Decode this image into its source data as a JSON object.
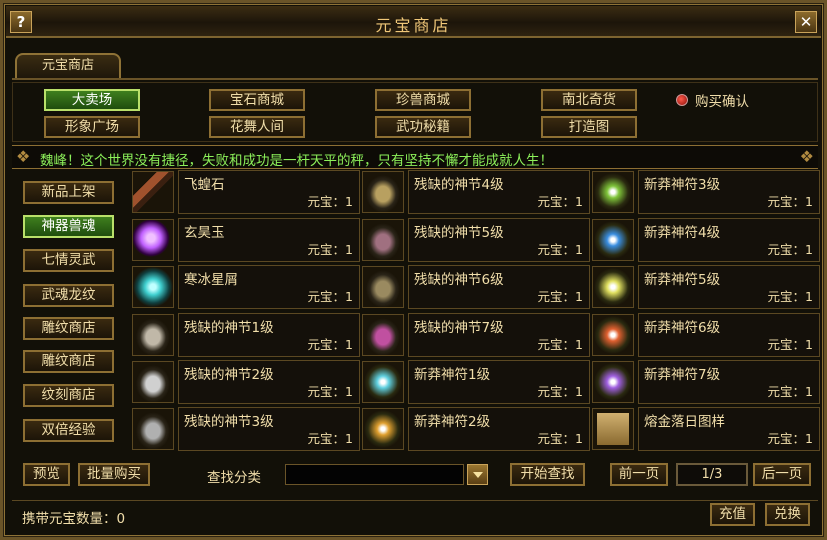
{
  "window": {
    "title": "元宝商店",
    "help_label": "?",
    "close_label": "✕"
  },
  "top_tab": {
    "label": "元宝商店"
  },
  "categories": [
    {
      "label": "大卖场",
      "active": true
    },
    {
      "label": "宝石商城",
      "active": false
    },
    {
      "label": "珍兽商城",
      "active": false
    },
    {
      "label": "南北奇货",
      "active": false
    },
    {
      "label": "形象广场",
      "active": false
    },
    {
      "label": "花舞人间",
      "active": false
    },
    {
      "label": "武功秘籍",
      "active": false
    },
    {
      "label": "打造图",
      "active": false
    }
  ],
  "confirm": {
    "label": "购买确认"
  },
  "notice": {
    "text": "魏峰！这个世界没有捷径，失败和成功是一杆天平的秤，只有坚持不懈才能成就人生！"
  },
  "sidebar": [
    {
      "label": "新品上架",
      "active": false
    },
    {
      "label": "神器兽魂",
      "active": true
    },
    {
      "label": "七情灵武",
      "active": false
    },
    {
      "label": "武魂龙纹",
      "active": false
    },
    {
      "label": "雕纹商店",
      "active": false
    },
    {
      "label": "雕纹商店",
      "active": false
    },
    {
      "label": "纹刻商店",
      "active": false
    },
    {
      "label": "双倍经验",
      "active": false
    }
  ],
  "items": [
    {
      "name": "飞蝗石",
      "price": "元宝：1",
      "icon": "stone-icon",
      "color": "#a0522d"
    },
    {
      "name": "残缺的神节4级",
      "price": "元宝：1",
      "icon": "artifact-fragment-icon",
      "color": "#b8a060"
    },
    {
      "name": "新莽神符3级",
      "price": "元宝：1",
      "icon": "talisman-icon",
      "color": "#7fc43a"
    },
    {
      "name": "玄昊玉",
      "price": "元宝：1",
      "icon": "jade-orb-icon",
      "color": "#c060ff"
    },
    {
      "name": "残缺的神节5级",
      "price": "元宝：1",
      "icon": "artifact-fragment-icon",
      "color": "#a07080"
    },
    {
      "name": "新莽神符4级",
      "price": "元宝：1",
      "icon": "talisman-icon",
      "color": "#3a8ee0"
    },
    {
      "name": "寒冰星屑",
      "price": "元宝：1",
      "icon": "ice-shard-icon",
      "color": "#40d0d0"
    },
    {
      "name": "残缺的神节6级",
      "price": "元宝：1",
      "icon": "artifact-fragment-icon",
      "color": "#9a8a60"
    },
    {
      "name": "新莽神符5级",
      "price": "元宝：1",
      "icon": "talisman-icon",
      "color": "#e0e060"
    },
    {
      "name": "残缺的神节1级",
      "price": "元宝：1",
      "icon": "artifact-fragment-icon",
      "color": "#c0b8a8"
    },
    {
      "name": "残缺的神节7级",
      "price": "元宝：1",
      "icon": "artifact-fragment-icon",
      "color": "#c050a0"
    },
    {
      "name": "新莽神符6级",
      "price": "元宝：1",
      "icon": "talisman-icon",
      "color": "#e06030"
    },
    {
      "name": "残缺的神节2级",
      "price": "元宝：1",
      "icon": "artifact-fragment-icon",
      "color": "#d0d0d0"
    },
    {
      "name": "新莽神符1级",
      "price": "元宝：1",
      "icon": "talisman-icon",
      "color": "#60d0e0"
    },
    {
      "name": "新莽神符7级",
      "price": "元宝：1",
      "icon": "talisman-icon",
      "color": "#a060e0"
    },
    {
      "name": "残缺的神节3级",
      "price": "元宝：1",
      "icon": "artifact-fragment-icon",
      "color": "#b0b0b0"
    },
    {
      "name": "新莽神符2级",
      "price": "元宝：1",
      "icon": "talisman-icon",
      "color": "#e0a030"
    },
    {
      "name": "熔金落日图样",
      "price": "元宝：1",
      "icon": "scroll-icon",
      "color": "#d0b070"
    }
  ],
  "bottom": {
    "preview_label": "预览",
    "bulk_buy_label": "批量购买",
    "search_label": "查找分类",
    "search_value": "",
    "start_search_label": "开始查找",
    "prev_label": "前一页",
    "page_text": "1/3",
    "next_label": "后一页"
  },
  "status": {
    "currency_text": "携带元宝数量：0",
    "recharge_label": "充值",
    "exchange_label": "兑换"
  }
}
